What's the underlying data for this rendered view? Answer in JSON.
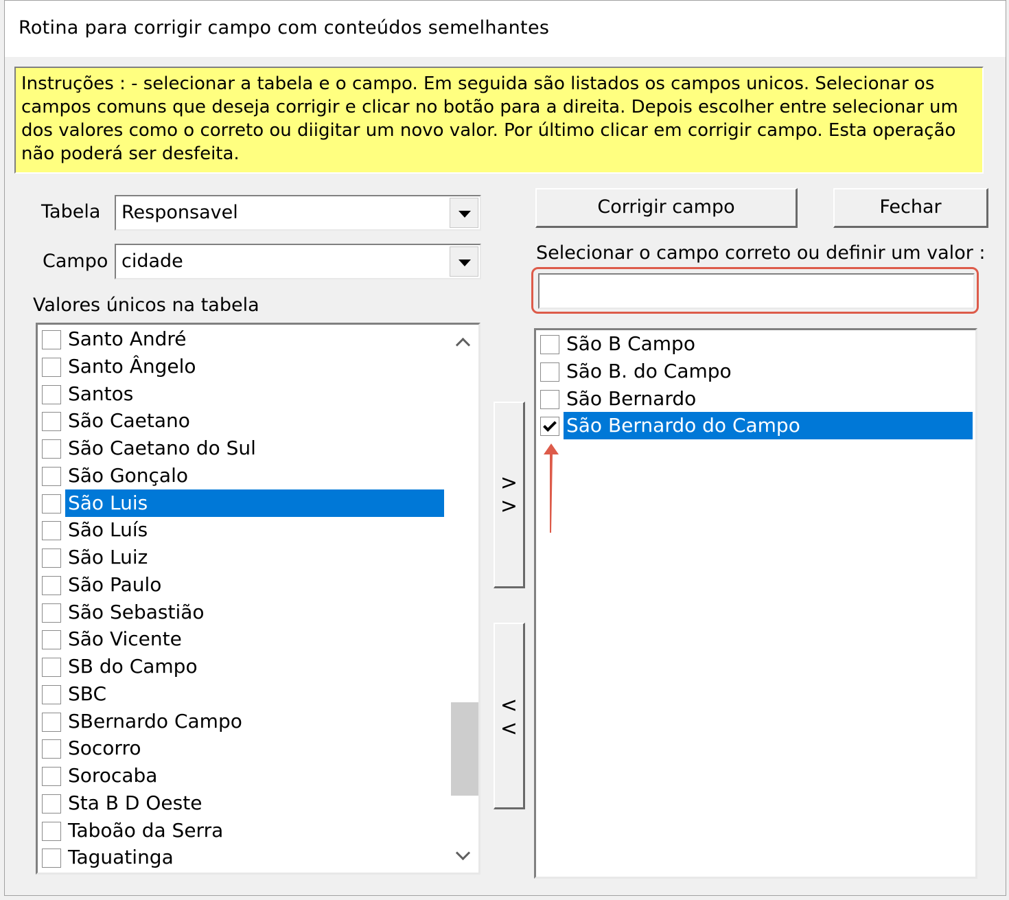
{
  "window": {
    "title": "Rotina para corrigir campo com conteúdos semelhantes"
  },
  "instructions": {
    "text": "Instruções : - selecionar a tabela e o campo. Em seguida são listados os campos unicos. Selecionar os campos comuns que deseja corrigir e clicar no botão para a direita. Depois escolher entre selecionar um dos valores como o correto ou diigitar um novo valor. Por último clicar em corrigir campo. Esta operação não poderá ser desfeita.",
    "background": "#ffff80"
  },
  "form": {
    "tabela_label": "Tabela",
    "tabela_value": "Responsavel",
    "campo_label": "Campo",
    "campo_value": "cidade",
    "unique_values_label": "Valores únicos na tabela"
  },
  "left_list": {
    "items": [
      {
        "label": "Santo André",
        "checked": false,
        "selected": false
      },
      {
        "label": "Santo Ângelo",
        "checked": false,
        "selected": false
      },
      {
        "label": "Santos",
        "checked": false,
        "selected": false
      },
      {
        "label": "São Caetano",
        "checked": false,
        "selected": false
      },
      {
        "label": "São Caetano do Sul",
        "checked": false,
        "selected": false
      },
      {
        "label": "São Gonçalo",
        "checked": false,
        "selected": false
      },
      {
        "label": "São Luis",
        "checked": false,
        "selected": true
      },
      {
        "label": "São Luís",
        "checked": false,
        "selected": false
      },
      {
        "label": "São Luiz",
        "checked": false,
        "selected": false
      },
      {
        "label": "São Paulo",
        "checked": false,
        "selected": false
      },
      {
        "label": "São Sebastião",
        "checked": false,
        "selected": false
      },
      {
        "label": "São Vicente",
        "checked": false,
        "selected": false
      },
      {
        "label": "SB do Campo",
        "checked": false,
        "selected": false
      },
      {
        "label": "SBC",
        "checked": false,
        "selected": false
      },
      {
        "label": "SBernardo Campo",
        "checked": false,
        "selected": false
      },
      {
        "label": "Socorro",
        "checked": false,
        "selected": false
      },
      {
        "label": "Sorocaba",
        "checked": false,
        "selected": false
      },
      {
        "label": "Sta B D Oeste",
        "checked": false,
        "selected": false
      },
      {
        "label": "Taboão da Serra",
        "checked": false,
        "selected": false
      },
      {
        "label": "Taguatinga",
        "checked": false,
        "selected": false
      }
    ]
  },
  "move_buttons": {
    "right_glyphs": [
      ">",
      ">"
    ],
    "left_glyphs": [
      "<",
      "<"
    ]
  },
  "actions": {
    "corrigir_label": "Corrigir campo",
    "fechar_label": "Fechar"
  },
  "right_panel": {
    "instruction_label": "Selecionar o campo correto ou definir um valor :",
    "value_input": "",
    "items": [
      {
        "label": "São B Campo",
        "checked": false,
        "selected": false
      },
      {
        "label": "São B. do Campo",
        "checked": false,
        "selected": false
      },
      {
        "label": "São Bernardo",
        "checked": false,
        "selected": false
      },
      {
        "label": "São Bernardo do Campo",
        "checked": true,
        "selected": true
      }
    ]
  },
  "colors": {
    "selection": "#0078d7",
    "annotation": "#dd5b4a"
  }
}
